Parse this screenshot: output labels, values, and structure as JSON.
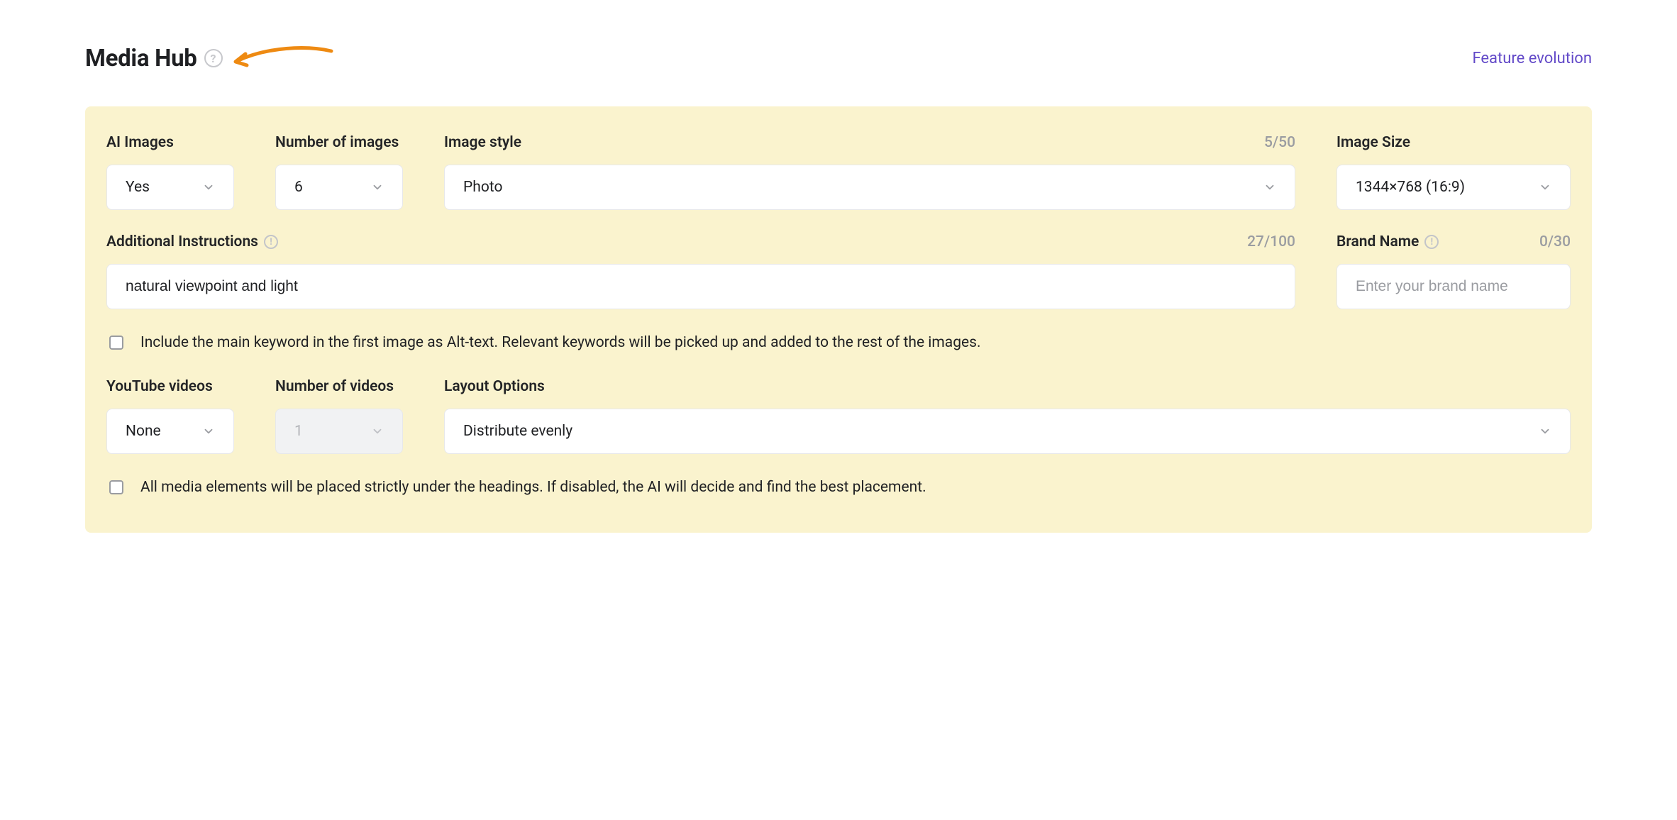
{
  "header": {
    "title": "Media Hub",
    "evolution_link": "Feature evolution"
  },
  "fields": {
    "ai_images": {
      "label": "AI Images",
      "value": "Yes"
    },
    "num_images": {
      "label": "Number of images",
      "value": "6"
    },
    "image_style": {
      "label": "Image style",
      "counter": "5/50",
      "value": "Photo"
    },
    "image_size": {
      "label": "Image Size",
      "value": "1344×768 (16:9)"
    },
    "instructions": {
      "label": "Additional Instructions",
      "counter": "27/100",
      "value": "natural viewpoint and light"
    },
    "brand": {
      "label": "Brand Name",
      "counter": "0/30",
      "placeholder": "Enter your brand name"
    },
    "youtube": {
      "label": "YouTube videos",
      "value": "None"
    },
    "num_videos": {
      "label": "Number of videos",
      "value": "1"
    },
    "layout": {
      "label": "Layout Options",
      "value": "Distribute evenly"
    }
  },
  "checks": {
    "alt_text": "Include the main keyword in the first image as Alt-text. Relevant keywords will be picked up and added to the rest of the images.",
    "placement": "All media elements will be placed strictly under the headings. If disabled, the AI will decide and find the best placement."
  }
}
